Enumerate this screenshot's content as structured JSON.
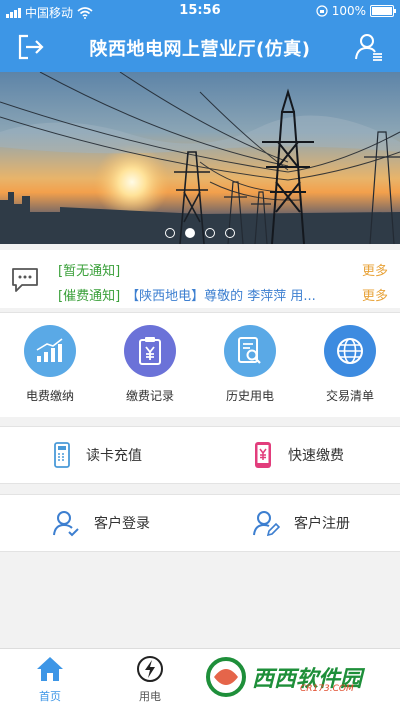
{
  "status_bar": {
    "carrier": "中国移动",
    "time": "15:56",
    "battery": "100%"
  },
  "header": {
    "title": "陕西地电网上营业厅(仿真)",
    "left_icon": "logout-icon",
    "right_icon": "user-settings-icon"
  },
  "banner": {
    "slide_count": 4,
    "active_slide": 2
  },
  "notices": [
    {
      "tag": "[暂无通知]",
      "text": "",
      "more": "更多"
    },
    {
      "tag": "[催费通知]",
      "text": "【陕西地电】尊敬的 李萍萍 用...",
      "more": "更多"
    }
  ],
  "features": [
    {
      "label": "电费缴纳",
      "icon": "bar-chart-icon",
      "color": "#5aa9e6"
    },
    {
      "label": "缴费记录",
      "icon": "clipboard-yen-icon",
      "color": "#6b72d8"
    },
    {
      "label": "历史用电",
      "icon": "document-search-icon",
      "color": "#5aa9e6"
    },
    {
      "label": "交易清单",
      "icon": "globe-icon",
      "color": "#3d8be0"
    }
  ],
  "actions_1": {
    "read_card": "读卡充值",
    "quick_pay": "快速缴费"
  },
  "actions_2": {
    "login": "客户登录",
    "register": "客户注册"
  },
  "tabbar": {
    "home": "首页",
    "power": "用电"
  },
  "watermark": {
    "text": "西西软件园",
    "sub": "CR173.COM"
  },
  "colors": {
    "primary": "#3d96e6",
    "notice_tag": "#3aa03a",
    "notice_text": "#3d7fd0",
    "more": "#e8a33a"
  }
}
